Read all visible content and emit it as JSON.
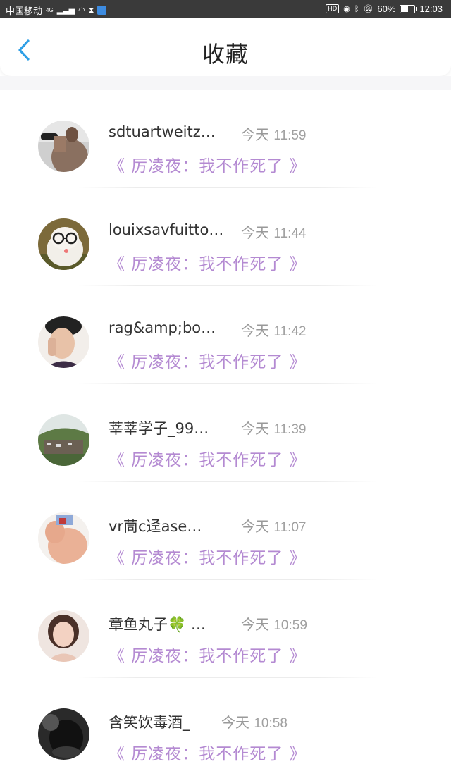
{
  "status_bar": {
    "carrier": "中国移动",
    "network": "4G",
    "battery_percent": "60%",
    "battery_level": 0.6,
    "time": "12:03",
    "icons": [
      "signal-icon",
      "wifi-icon",
      "hourglass-icon",
      "app-notification-icon",
      "hd-icon",
      "eye-icon",
      "bluetooth-icon",
      "mute-icon",
      "battery-icon"
    ]
  },
  "header": {
    "title": "收藏",
    "back_icon": "chevron-left-icon",
    "accent_color": "#2e9fe6"
  },
  "colors": {
    "book_title": "#b48ad2",
    "time_text": "#999999"
  },
  "favorites": [
    {
      "username": "sdtuartweitz…",
      "day": "今天",
      "time": "11:59",
      "book": "《 厉凌夜：我不作死了 》"
    },
    {
      "username": "louixsavfuitto…",
      "day": "今天",
      "time": "11:44",
      "book": "《 厉凌夜：我不作死了 》"
    },
    {
      "username": "rag&amp;bo…",
      "day": "今天",
      "time": "11:42",
      "book": "《 厉凌夜：我不作死了 》"
    },
    {
      "username": "莘莘学子_99…",
      "day": "今天",
      "time": "11:39",
      "book": "《 厉凌夜：我不作死了 》"
    },
    {
      "username": "vr茼c迳ase…",
      "day": "今天",
      "time": "11:07",
      "book": "《 厉凌夜：我不作死了 》"
    },
    {
      "username": "章鱼丸子🍀 …",
      "day": "今天",
      "time": "10:59",
      "book": "《 厉凌夜：我不作死了 》"
    },
    {
      "username": "含笑饮毒酒_",
      "day": "今天",
      "time": "10:58",
      "book": "《 厉凌夜：我不作死了 》"
    }
  ]
}
